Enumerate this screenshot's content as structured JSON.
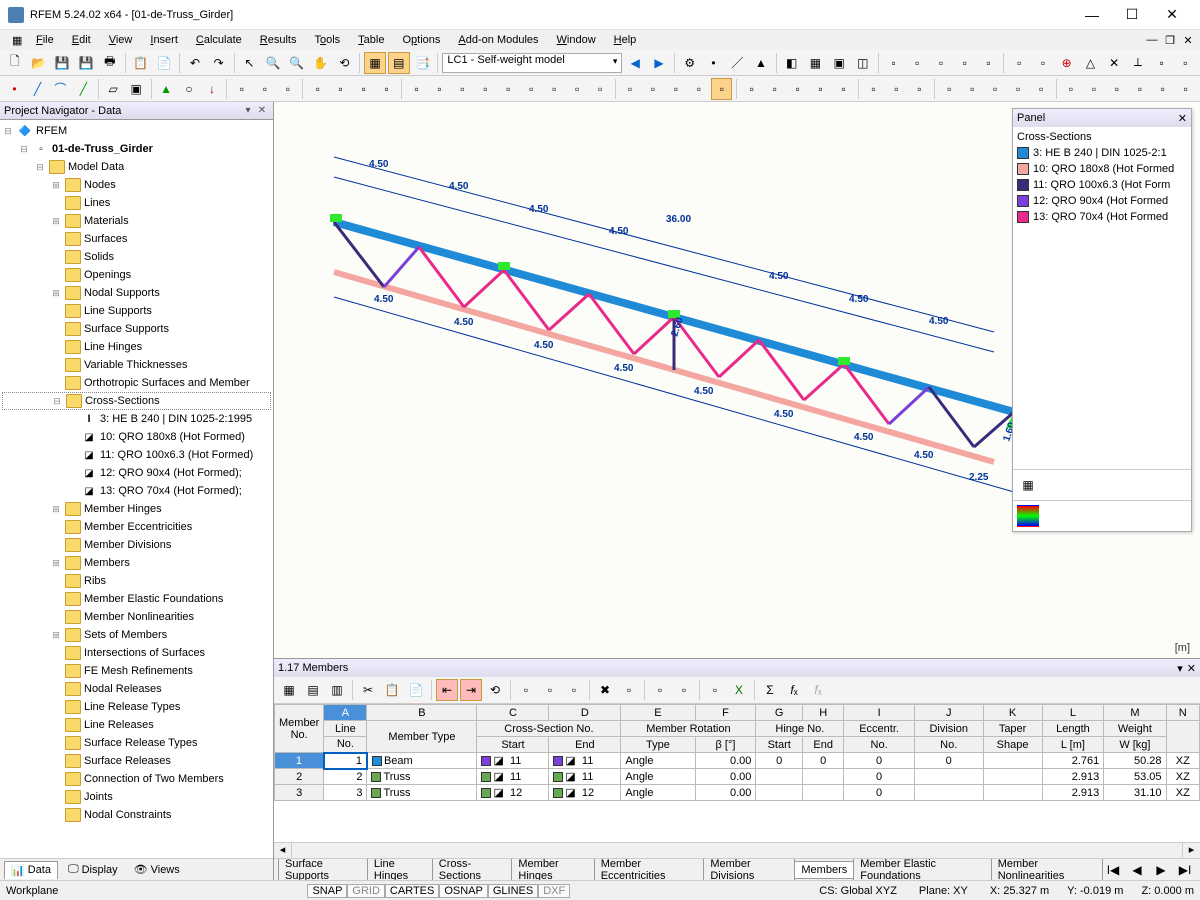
{
  "window": {
    "title": "RFEM 5.24.02 x64 - [01-de-Truss_Girder]"
  },
  "menu": [
    "File",
    "Edit",
    "View",
    "Insert",
    "Calculate",
    "Results",
    "Tools",
    "Table",
    "Options",
    "Add-on Modules",
    "Window",
    "Help"
  ],
  "combo": {
    "loadcase": "LC1 - Self-weight model"
  },
  "navigator": {
    "title": "Project Navigator - Data",
    "root": "RFEM",
    "project": "01-de-Truss_Girder",
    "model_data": "Model Data",
    "items": [
      "Nodes",
      "Lines",
      "Materials",
      "Surfaces",
      "Solids",
      "Openings",
      "Nodal Supports",
      "Line Supports",
      "Surface Supports",
      "Line Hinges",
      "Variable Thicknesses",
      "Orthotropic Surfaces and Member"
    ],
    "cs_label": "Cross-Sections",
    "cs": [
      "3: HE B 240 | DIN 1025-2:1995",
      "10: QRO 180x8 (Hot Formed)",
      "11: QRO 100x6.3 (Hot Formed)",
      "12: QRO 90x4 (Hot Formed);",
      "13: QRO 70x4 (Hot Formed);"
    ],
    "items2": [
      "Member Hinges",
      "Member Eccentricities",
      "Member Divisions",
      "Members",
      "Ribs",
      "Member Elastic Foundations",
      "Member Nonlinearities",
      "Sets of Members",
      "Intersections of Surfaces",
      "FE Mesh Refinements",
      "Nodal Releases",
      "Line Release Types",
      "Line Releases",
      "Surface Release Types",
      "Surface Releases",
      "Connection of Two Members",
      "Joints",
      "Nodal Constraints"
    ],
    "tabs": [
      "Data",
      "Display",
      "Views"
    ]
  },
  "legend": {
    "title": "Panel",
    "section_title": "Cross-Sections",
    "items": [
      {
        "color": "#1f8ad6",
        "label": "3: HE B 240 | DIN 1025-2:1"
      },
      {
        "color": "#f4a6a0",
        "label": "10: QRO 180x8 (Hot Formed"
      },
      {
        "color": "#3b2a7a",
        "label": "11: QRO 100x6.3 (Hot Form"
      },
      {
        "color": "#7a3fd6",
        "label": "12: QRO 90x4 (Hot Formed"
      },
      {
        "color": "#e82a8a",
        "label": "13: QRO 70x4 (Hot Formed"
      }
    ],
    "unit": "[m]"
  },
  "truss_dims": {
    "top": [
      "4.50",
      "4.50",
      "4.50",
      "4.50",
      "36.00",
      "4.50",
      "4.50",
      "4.50"
    ],
    "bottom": [
      "4.50",
      "4.50",
      "4.50",
      "4.50",
      "4.50",
      "4.50",
      "4.50",
      "4.50",
      "2.25"
    ],
    "height": "2.60",
    "end": "1.60"
  },
  "bottom": {
    "title": "1.17 Members",
    "cols_letters": [
      "A",
      "B",
      "C",
      "D",
      "E",
      "F",
      "G",
      "H",
      "I",
      "J",
      "K",
      "L",
      "M",
      "N"
    ],
    "head1": {
      "member": "Member",
      "line": "Line",
      "mtype": "Member Type",
      "csno": "Cross-Section No.",
      "mrot": "Member Rotation",
      "hinge": "Hinge No.",
      "ecc": "Eccentr.",
      "div": "Division",
      "taper": "Taper",
      "len": "Length",
      "wt": "Weight"
    },
    "head2": {
      "no": "No.",
      "start": "Start",
      "end": "End",
      "type": "Type",
      "beta": "β [°]",
      "eccno": "No.",
      "divno": "No.",
      "shape": "Shape",
      "L": "L [m]",
      "W": "W [kg]"
    },
    "rows": [
      {
        "no": "1",
        "line": "1",
        "type": "Beam",
        "csColor": "#7a3fd6",
        "csStart": "11",
        "csEnd": "11",
        "rotType": "Angle",
        "rotVal": "0.00",
        "hStart": "0",
        "hEnd": "0",
        "ecc": "0",
        "div": "0",
        "L": "2.761",
        "W": "50.28",
        "ax": "XZ"
      },
      {
        "no": "2",
        "line": "2",
        "type": "Truss",
        "csColor": "#6aa84f",
        "csStart": "11",
        "csEnd": "11",
        "rotType": "Angle",
        "rotVal": "0.00",
        "hStart": "",
        "hEnd": "",
        "ecc": "0",
        "div": "",
        "L": "2.913",
        "W": "53.05",
        "ax": "XZ"
      },
      {
        "no": "3",
        "line": "3",
        "type": "Truss",
        "csColor": "#6aa84f",
        "csStart": "12",
        "csEnd": "12",
        "rotType": "Angle",
        "rotVal": "0.00",
        "hStart": "",
        "hEnd": "",
        "ecc": "0",
        "div": "",
        "L": "2.913",
        "W": "31.10",
        "ax": "XZ"
      }
    ],
    "tabs": [
      "Surface Supports",
      "Line Hinges",
      "Cross-Sections",
      "Member Hinges",
      "Member Eccentricities",
      "Member Divisions",
      "Members",
      "Member Elastic Foundations",
      "Member Nonlinearities"
    ],
    "active_tab": 6
  },
  "status": {
    "left": "Workplane",
    "toggles": [
      "SNAP",
      "GRID",
      "CARTES",
      "OSNAP",
      "GLINES",
      "DXF"
    ],
    "cs": "CS: Global XYZ",
    "plane": "Plane: XY",
    "x": "X:  25.327 m",
    "y": "Y:  -0.019 m",
    "z": "Z:  0.000 m"
  }
}
